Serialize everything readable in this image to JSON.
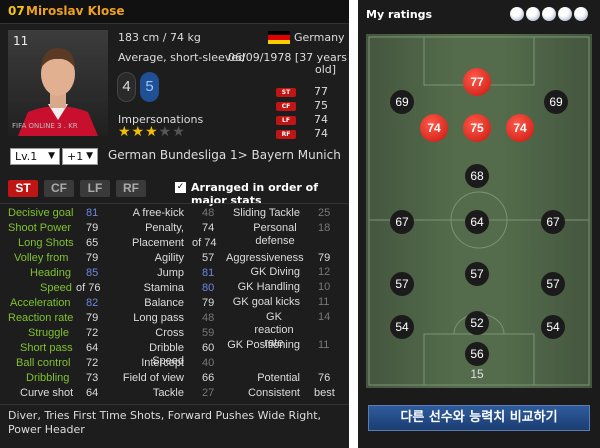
{
  "player": {
    "season": "07",
    "name": "Miroslav Klose",
    "number": "11",
    "height_weight": "183 cm / 74 kg",
    "build": "Average, short-sleeved",
    "nation": "Germany",
    "dob": "06/09/1978 [37 years",
    "age_line": "old]",
    "weak_foot": "4",
    "skill": "5",
    "impersonations_label": "Impersonations",
    "stars": 3,
    "photo_caption": "FIFA ONLINE 3 . KR"
  },
  "position_ovr": [
    {
      "pos": "ST",
      "val": "77"
    },
    {
      "pos": "CF",
      "val": "75"
    },
    {
      "pos": "LF",
      "val": "74"
    },
    {
      "pos": "RF",
      "val": "74"
    }
  ],
  "level_select": "Lv.1",
  "plus_select": "+1",
  "club": "German Bundesliga 1> Bayern Munich",
  "positions": [
    "ST",
    "CF",
    "LF",
    "RF"
  ],
  "arranged_label": "Arranged in order of major stats",
  "col1": [
    {
      "n": "Decisive goal",
      "v": "81"
    },
    {
      "n": "Shoot Power",
      "v": "79"
    },
    {
      "n": "Long Shots",
      "v": "65"
    },
    {
      "n": "Volley from",
      "v": "79"
    },
    {
      "n": "Heading",
      "v": "85"
    },
    {
      "n": "Speed",
      "v": "of 76"
    },
    {
      "n": "Acceleration",
      "v": "82"
    },
    {
      "n": "Reaction rate",
      "v": "79"
    },
    {
      "n": "Struggle",
      "v": "72"
    },
    {
      "n": "Short pass",
      "v": "64"
    },
    {
      "n": "Ball control",
      "v": "72"
    },
    {
      "n": "Dribbling",
      "v": "73"
    },
    {
      "n": "Curve shot",
      "v": "64"
    }
  ],
  "col2": [
    {
      "n": "A free-kick",
      "v": "48"
    },
    {
      "n": "Penalty,",
      "v": "74"
    },
    {
      "n": "Placement",
      "v": "of 74"
    },
    {
      "n": "Agility",
      "v": "57"
    },
    {
      "n": "Jump",
      "v": "81"
    },
    {
      "n": "Stamina",
      "v": "80"
    },
    {
      "n": "Balance",
      "v": "79"
    },
    {
      "n": "Long pass",
      "v": "48"
    },
    {
      "n": "Cross",
      "v": "59"
    },
    {
      "n": "Dribble Speed",
      "v": "60"
    },
    {
      "n": "Intercept",
      "v": "40"
    },
    {
      "n": "Field of view",
      "v": "66"
    },
    {
      "n": "Tackle",
      "v": "27"
    }
  ],
  "col3": [
    {
      "n": "Sliding Tackle",
      "v": "25"
    },
    {
      "n": "Personal defense",
      "v": "18"
    },
    {
      "n": "Aggressiveness",
      "v": "79"
    },
    {
      "n": "GK Diving",
      "v": "12"
    },
    {
      "n": "GK Handling",
      "v": "10"
    },
    {
      "n": "GK goal kicks",
      "v": "11"
    },
    {
      "n": "GK reaction rate",
      "v": "14"
    },
    {
      "n": "GK Positioning",
      "v": "11"
    },
    {
      "n": "Potential",
      "v": "76"
    },
    {
      "n": "Consistent",
      "v": "best"
    }
  ],
  "traits": "Diver, Tries First Time Shots, Forward Pushes Wide Right, Power Header",
  "ratings_title": "My ratings",
  "pitch_ratings": {
    "st": "77",
    "lw": "69",
    "rw": "69",
    "lf": "74",
    "cf": "75",
    "rf": "74",
    "cam": "68",
    "lm": "67",
    "cm": "64",
    "rm": "67",
    "lcdm": "57",
    "cdm": "57",
    "rcdm": "57",
    "lb": "54",
    "cb": "52",
    "rb": "54",
    "sw": "56",
    "gk": "15"
  },
  "compare_button": "다른 선수와 능력치 비교하기",
  "colors": {
    "accent_red": "#c01515",
    "green_stat": "#7fc230",
    "blue_stat": "#6b88e0",
    "compare_blue": "#2f5c9d"
  }
}
